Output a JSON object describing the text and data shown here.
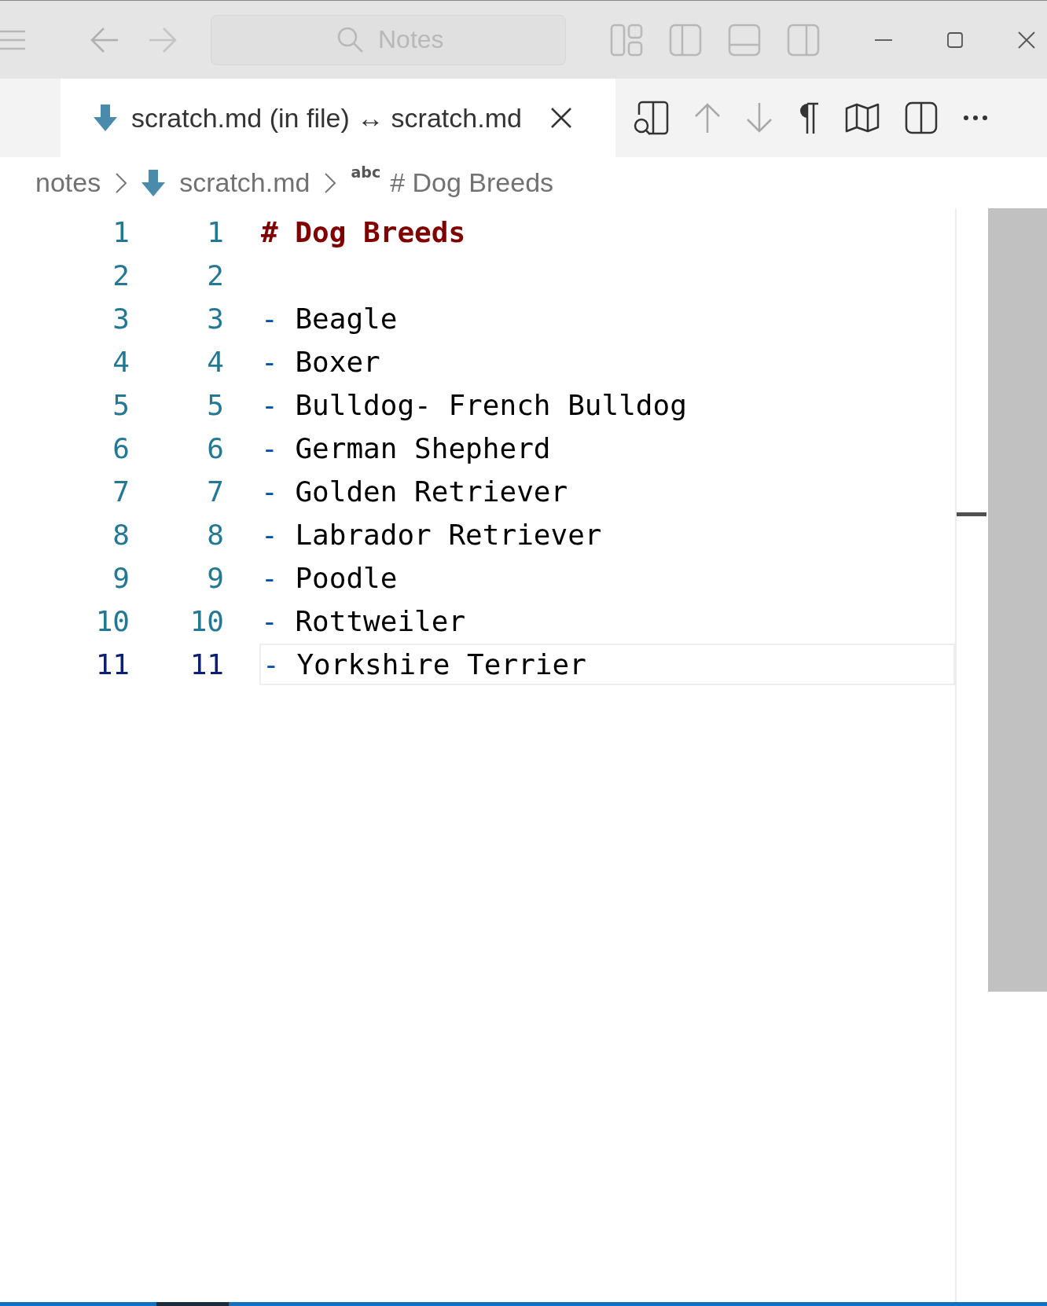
{
  "title_bar": {
    "search": {
      "placeholder": "Notes"
    }
  },
  "tab": {
    "title": "scratch.md (in file) ↔ scratch.md",
    "selected": true
  },
  "breadcrumb": {
    "items": [
      "notes",
      "scratch.md"
    ],
    "symbol_badge": "abc",
    "symbol": "# Dog Breeds"
  },
  "lines": [
    {
      "original": "1",
      "modified": "1",
      "kind": "heading",
      "text": "# Dog Breeds",
      "current": false
    },
    {
      "original": "2",
      "modified": "2",
      "kind": "blank",
      "current": false
    },
    {
      "original": "3",
      "modified": "3",
      "kind": "list",
      "marker": "-",
      "text": "Beagle",
      "current": false
    },
    {
      "original": "4",
      "modified": "4",
      "kind": "list",
      "marker": "-",
      "text": "Boxer",
      "current": false
    },
    {
      "original": "5",
      "modified": "5",
      "kind": "list",
      "marker": "-",
      "text": "Bulldog- French Bulldog",
      "current": false
    },
    {
      "original": "6",
      "modified": "6",
      "kind": "list",
      "marker": "-",
      "text": "German Shepherd",
      "current": false
    },
    {
      "original": "7",
      "modified": "7",
      "kind": "list",
      "marker": "-",
      "text": "Golden Retriever",
      "current": false
    },
    {
      "original": "8",
      "modified": "8",
      "kind": "list",
      "marker": "-",
      "text": "Labrador Retriever",
      "current": false
    },
    {
      "original": "9",
      "modified": "9",
      "kind": "list",
      "marker": "-",
      "text": "Poodle",
      "current": false
    },
    {
      "original": "10",
      "modified": "10",
      "kind": "list",
      "marker": "-",
      "text": "Rottweiler",
      "current": false
    },
    {
      "original": "11",
      "modified": "11",
      "kind": "list",
      "marker": "-",
      "text": "Yorkshire Terrier",
      "current": true
    }
  ]
}
